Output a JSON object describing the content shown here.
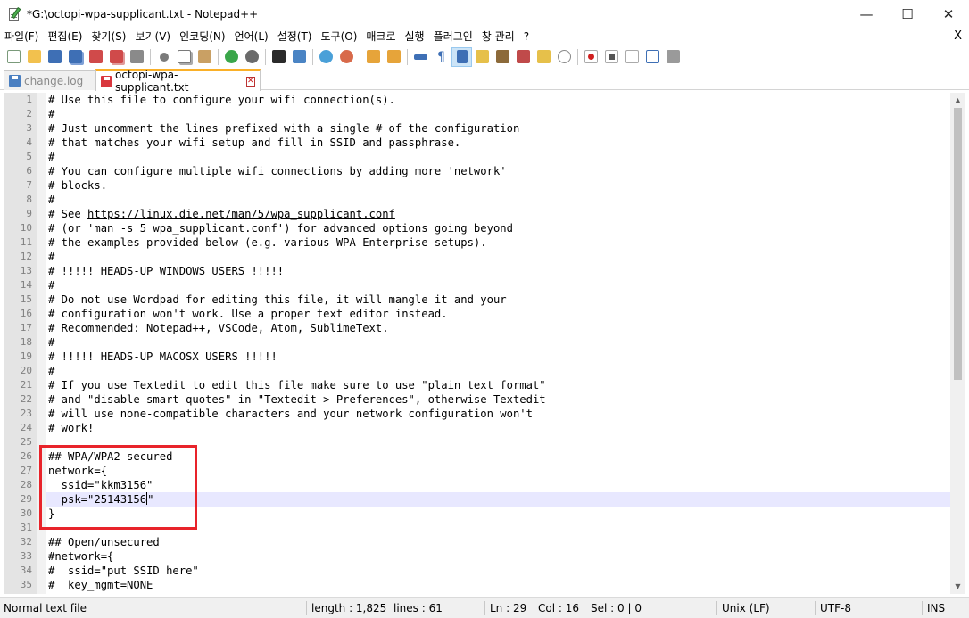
{
  "window": {
    "title": "*G:\\octopi-wpa-supplicant.txt - Notepad++",
    "minimize": "—",
    "maximize": "☐",
    "close": "✕"
  },
  "menu": {
    "items": [
      "파일(F)",
      "편집(E)",
      "찾기(S)",
      "보기(V)",
      "인코딩(N)",
      "언어(L)",
      "설정(T)",
      "도구(O)",
      "매크로",
      "실행",
      "플러그인",
      "창 관리",
      "?"
    ],
    "close_doc": "X"
  },
  "toolbar": {
    "buttons": [
      "new-file-icon",
      "open-file-icon",
      "save-icon",
      "save-all-icon",
      "close-icon",
      "close-all-icon",
      "print-icon",
      "cut-icon",
      "copy-icon",
      "paste-icon",
      "undo-icon",
      "redo-icon",
      "find-icon",
      "replace-icon",
      "zoom-in-icon",
      "zoom-out-icon",
      "sync-vertical-icon",
      "sync-horizontal-icon",
      "word-wrap-icon",
      "show-all-chars-icon",
      "indent-guide-icon",
      "document-map-icon",
      "function-list-icon",
      "udl-icon",
      "folder-workspace-icon",
      "monitoring-icon",
      "record-macro-icon",
      "stop-macro-icon",
      "play-macro-icon",
      "run-macro-multiple-icon",
      "save-macro-icon"
    ]
  },
  "tabs": [
    {
      "label": "change.log",
      "active": false,
      "icon_color": "#4a7fc1"
    },
    {
      "label": "octopi-wpa-supplicant.txt",
      "active": true,
      "icon_color": "#d9373e"
    }
  ],
  "editor": {
    "lines": [
      "# Use this file to configure your wifi connection(s).",
      "#",
      "# Just uncomment the lines prefixed with a single # of the configuration",
      "# that matches your wifi setup and fill in SSID and passphrase.",
      "#",
      "# You can configure multiple wifi connections by adding more 'network'",
      "# blocks.",
      "#",
      "# See https://linux.die.net/man/5/wpa_supplicant.conf",
      "# (or 'man -s 5 wpa_supplicant.conf') for advanced options going beyond",
      "# the examples provided below (e.g. various WPA Enterprise setups).",
      "#",
      "# !!!!! HEADS-UP WINDOWS USERS !!!!!",
      "#",
      "# Do not use Wordpad for editing this file, it will mangle it and your",
      "# configuration won't work. Use a proper text editor instead.",
      "# Recommended: Notepad++, VSCode, Atom, SublimeText.",
      "#",
      "# !!!!! HEADS-UP MACOSX USERS !!!!!",
      "#",
      "# If you use Textedit to edit this file make sure to use \"plain text format\"",
      "# and \"disable smart quotes\" in \"Textedit > Preferences\", otherwise Textedit",
      "# will use none-compatible characters and your network configuration won't",
      "# work!",
      "",
      "## WPA/WPA2 secured",
      "network={",
      "  ssid=\"kkm3156\"",
      "  psk=\"25143156\"",
      "}",
      "",
      "## Open/unsecured",
      "#network={",
      "#  ssid=\"put SSID here\"",
      "#  key_mgmt=NONE"
    ],
    "url": "https://linux.die.net/man/5/wpa_supplicant.conf",
    "current_line": 29,
    "highlight_color": "#e8232a"
  },
  "status": {
    "mode": "Normal text file",
    "length": "length : 1,825",
    "lines": "lines : 61",
    "ln": "Ln : 29",
    "col": "Col : 16",
    "sel": "Sel : 0 | 0",
    "eol": "Unix (LF)",
    "encoding": "UTF-8",
    "ins": "INS"
  }
}
